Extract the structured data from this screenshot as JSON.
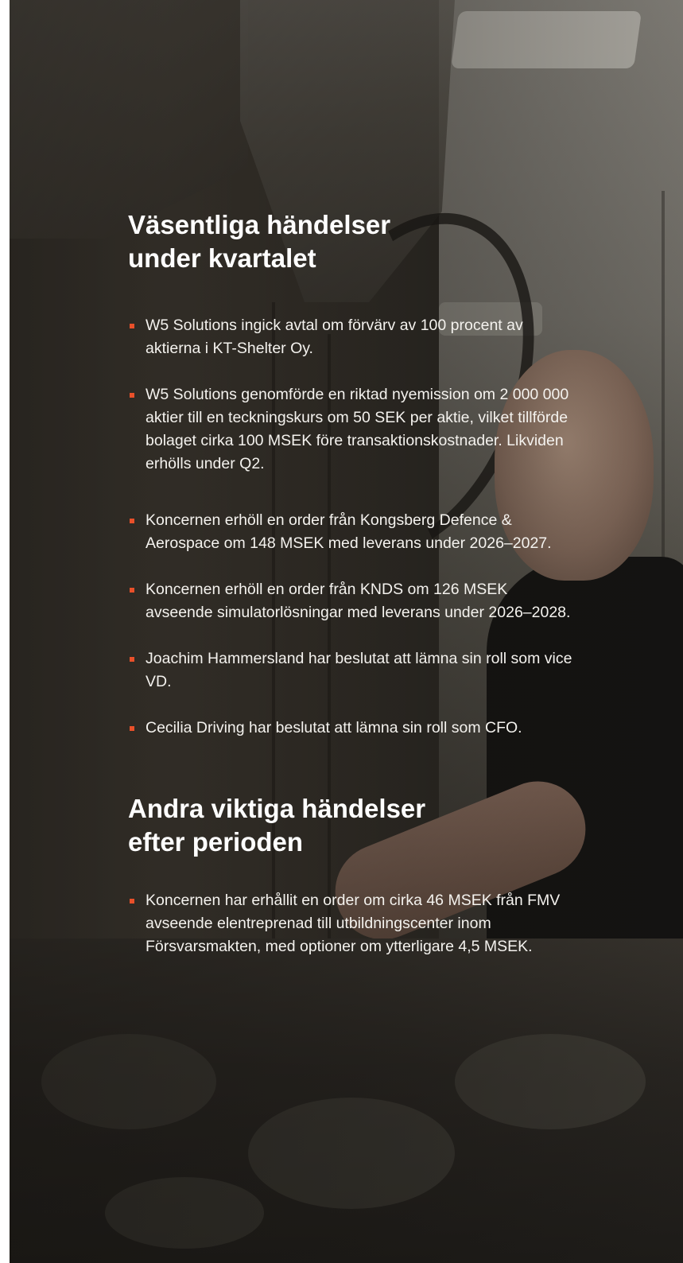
{
  "section_1": {
    "heading_line_1": "Väsentliga händelser",
    "heading_line_2": "under kvartalet",
    "items": [
      "W5 Solutions ingick avtal om förvärv av 100 procent av aktierna i KT-Shelter Oy.",
      "W5 Solutions genomförde en riktad nyemission om 2 000 000 aktier till en teckningskurs om 50 SEK per aktie, vilket tillförde bolaget cirka 100 MSEK före transaktionskostnader. Likviden erhölls under Q2.",
      "Koncernen erhöll en order från Kongsberg Defence & Aerospace om 148 MSEK med leverans under 2026–2027.",
      "Koncernen erhöll en order från KNDS om 126 MSEK avseende simulatorlösningar med leverans under 2026–2028.",
      "Joachim Hammersland har beslutat att lämna sin roll som vice VD.",
      "Cecilia Driving har beslutat att lämna sin roll som CFO."
    ]
  },
  "section_2": {
    "heading_line_1": "Andra viktiga händelser",
    "heading_line_2": "efter perioden",
    "items": [
      "Koncernen har erhållit en order om cirka 46 MSEK från FMV avseende elentreprenad till utbildningscenter inom Försvarsmakten, med optioner om ytterligare 4,5 MSEK."
    ]
  },
  "colors": {
    "bullet": "#e8502a",
    "text": "#ffffff"
  }
}
